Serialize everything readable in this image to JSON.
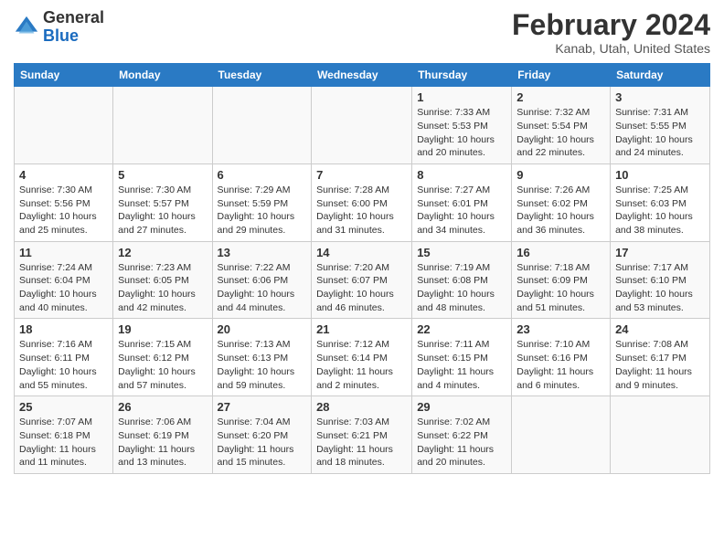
{
  "logo": {
    "text_general": "General",
    "text_blue": "Blue"
  },
  "title": "February 2024",
  "subtitle": "Kanab, Utah, United States",
  "days_of_week": [
    "Sunday",
    "Monday",
    "Tuesday",
    "Wednesday",
    "Thursday",
    "Friday",
    "Saturday"
  ],
  "weeks": [
    [
      {
        "day": "",
        "sunrise": "",
        "sunset": "",
        "daylight": ""
      },
      {
        "day": "",
        "sunrise": "",
        "sunset": "",
        "daylight": ""
      },
      {
        "day": "",
        "sunrise": "",
        "sunset": "",
        "daylight": ""
      },
      {
        "day": "",
        "sunrise": "",
        "sunset": "",
        "daylight": ""
      },
      {
        "day": "1",
        "sunrise": "Sunrise: 7:33 AM",
        "sunset": "Sunset: 5:53 PM",
        "daylight": "Daylight: 10 hours and 20 minutes."
      },
      {
        "day": "2",
        "sunrise": "Sunrise: 7:32 AM",
        "sunset": "Sunset: 5:54 PM",
        "daylight": "Daylight: 10 hours and 22 minutes."
      },
      {
        "day": "3",
        "sunrise": "Sunrise: 7:31 AM",
        "sunset": "Sunset: 5:55 PM",
        "daylight": "Daylight: 10 hours and 24 minutes."
      }
    ],
    [
      {
        "day": "4",
        "sunrise": "Sunrise: 7:30 AM",
        "sunset": "Sunset: 5:56 PM",
        "daylight": "Daylight: 10 hours and 25 minutes."
      },
      {
        "day": "5",
        "sunrise": "Sunrise: 7:30 AM",
        "sunset": "Sunset: 5:57 PM",
        "daylight": "Daylight: 10 hours and 27 minutes."
      },
      {
        "day": "6",
        "sunrise": "Sunrise: 7:29 AM",
        "sunset": "Sunset: 5:59 PM",
        "daylight": "Daylight: 10 hours and 29 minutes."
      },
      {
        "day": "7",
        "sunrise": "Sunrise: 7:28 AM",
        "sunset": "Sunset: 6:00 PM",
        "daylight": "Daylight: 10 hours and 31 minutes."
      },
      {
        "day": "8",
        "sunrise": "Sunrise: 7:27 AM",
        "sunset": "Sunset: 6:01 PM",
        "daylight": "Daylight: 10 hours and 34 minutes."
      },
      {
        "day": "9",
        "sunrise": "Sunrise: 7:26 AM",
        "sunset": "Sunset: 6:02 PM",
        "daylight": "Daylight: 10 hours and 36 minutes."
      },
      {
        "day": "10",
        "sunrise": "Sunrise: 7:25 AM",
        "sunset": "Sunset: 6:03 PM",
        "daylight": "Daylight: 10 hours and 38 minutes."
      }
    ],
    [
      {
        "day": "11",
        "sunrise": "Sunrise: 7:24 AM",
        "sunset": "Sunset: 6:04 PM",
        "daylight": "Daylight: 10 hours and 40 minutes."
      },
      {
        "day": "12",
        "sunrise": "Sunrise: 7:23 AM",
        "sunset": "Sunset: 6:05 PM",
        "daylight": "Daylight: 10 hours and 42 minutes."
      },
      {
        "day": "13",
        "sunrise": "Sunrise: 7:22 AM",
        "sunset": "Sunset: 6:06 PM",
        "daylight": "Daylight: 10 hours and 44 minutes."
      },
      {
        "day": "14",
        "sunrise": "Sunrise: 7:20 AM",
        "sunset": "Sunset: 6:07 PM",
        "daylight": "Daylight: 10 hours and 46 minutes."
      },
      {
        "day": "15",
        "sunrise": "Sunrise: 7:19 AM",
        "sunset": "Sunset: 6:08 PM",
        "daylight": "Daylight: 10 hours and 48 minutes."
      },
      {
        "day": "16",
        "sunrise": "Sunrise: 7:18 AM",
        "sunset": "Sunset: 6:09 PM",
        "daylight": "Daylight: 10 hours and 51 minutes."
      },
      {
        "day": "17",
        "sunrise": "Sunrise: 7:17 AM",
        "sunset": "Sunset: 6:10 PM",
        "daylight": "Daylight: 10 hours and 53 minutes."
      }
    ],
    [
      {
        "day": "18",
        "sunrise": "Sunrise: 7:16 AM",
        "sunset": "Sunset: 6:11 PM",
        "daylight": "Daylight: 10 hours and 55 minutes."
      },
      {
        "day": "19",
        "sunrise": "Sunrise: 7:15 AM",
        "sunset": "Sunset: 6:12 PM",
        "daylight": "Daylight: 10 hours and 57 minutes."
      },
      {
        "day": "20",
        "sunrise": "Sunrise: 7:13 AM",
        "sunset": "Sunset: 6:13 PM",
        "daylight": "Daylight: 10 hours and 59 minutes."
      },
      {
        "day": "21",
        "sunrise": "Sunrise: 7:12 AM",
        "sunset": "Sunset: 6:14 PM",
        "daylight": "Daylight: 11 hours and 2 minutes."
      },
      {
        "day": "22",
        "sunrise": "Sunrise: 7:11 AM",
        "sunset": "Sunset: 6:15 PM",
        "daylight": "Daylight: 11 hours and 4 minutes."
      },
      {
        "day": "23",
        "sunrise": "Sunrise: 7:10 AM",
        "sunset": "Sunset: 6:16 PM",
        "daylight": "Daylight: 11 hours and 6 minutes."
      },
      {
        "day": "24",
        "sunrise": "Sunrise: 7:08 AM",
        "sunset": "Sunset: 6:17 PM",
        "daylight": "Daylight: 11 hours and 9 minutes."
      }
    ],
    [
      {
        "day": "25",
        "sunrise": "Sunrise: 7:07 AM",
        "sunset": "Sunset: 6:18 PM",
        "daylight": "Daylight: 11 hours and 11 minutes."
      },
      {
        "day": "26",
        "sunrise": "Sunrise: 7:06 AM",
        "sunset": "Sunset: 6:19 PM",
        "daylight": "Daylight: 11 hours and 13 minutes."
      },
      {
        "day": "27",
        "sunrise": "Sunrise: 7:04 AM",
        "sunset": "Sunset: 6:20 PM",
        "daylight": "Daylight: 11 hours and 15 minutes."
      },
      {
        "day": "28",
        "sunrise": "Sunrise: 7:03 AM",
        "sunset": "Sunset: 6:21 PM",
        "daylight": "Daylight: 11 hours and 18 minutes."
      },
      {
        "day": "29",
        "sunrise": "Sunrise: 7:02 AM",
        "sunset": "Sunset: 6:22 PM",
        "daylight": "Daylight: 11 hours and 20 minutes."
      },
      {
        "day": "",
        "sunrise": "",
        "sunset": "",
        "daylight": ""
      },
      {
        "day": "",
        "sunrise": "",
        "sunset": "",
        "daylight": ""
      }
    ]
  ]
}
